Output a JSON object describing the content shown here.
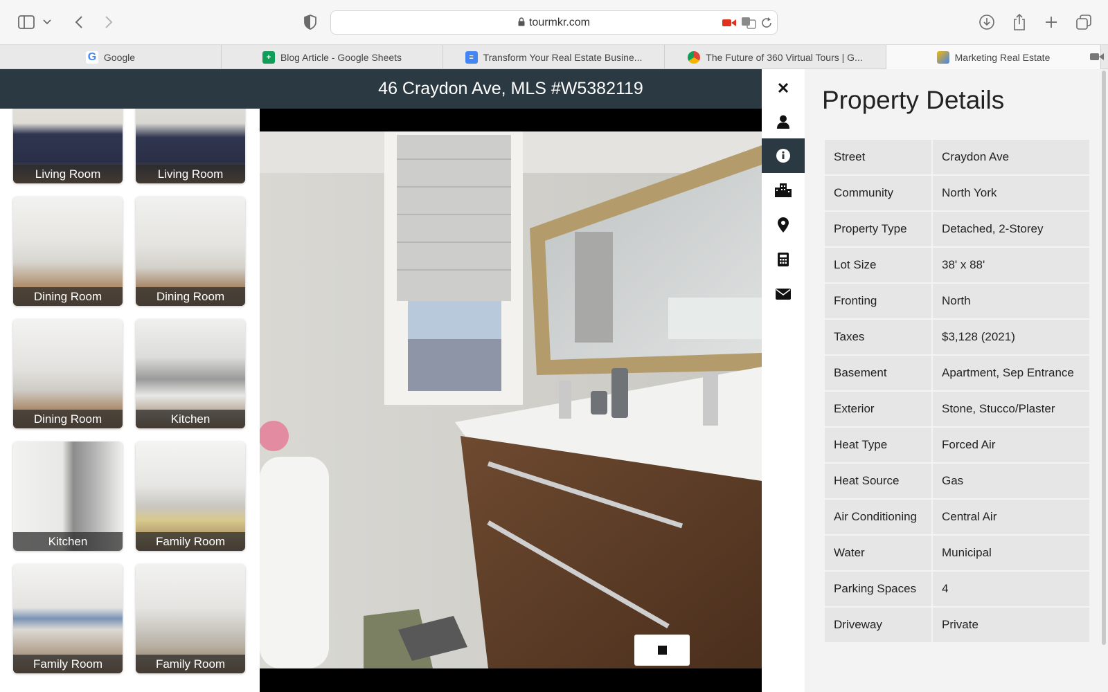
{
  "browser": {
    "url": "tourmkr.com",
    "tabs": [
      {
        "label": "Google",
        "icon": "google-icon",
        "color": "#4285f4"
      },
      {
        "label": "Blog Article - Google Sheets",
        "icon": "sheets-icon",
        "color": "#0f9d58"
      },
      {
        "label": "Transform Your Real Estate Busine...",
        "icon": "docs-icon",
        "color": "#4285f4"
      },
      {
        "label": "The Future of 360 Virtual Tours | G...",
        "icon": "chrome-icon",
        "color": "#db4437"
      },
      {
        "label": "Marketing Real Estate",
        "icon": "cube-icon",
        "color": "#f4b400"
      }
    ]
  },
  "listing": {
    "title": "46 Craydon Ave, MLS #W5382119"
  },
  "thumbnails": [
    {
      "label": "Living Room"
    },
    {
      "label": "Living Room"
    },
    {
      "label": "Dining Room"
    },
    {
      "label": "Dining Room"
    },
    {
      "label": "Dining Room"
    },
    {
      "label": "Kitchen"
    },
    {
      "label": "Kitchen"
    },
    {
      "label": "Family Room"
    },
    {
      "label": "Family Room"
    },
    {
      "label": "Family Room"
    }
  ],
  "sidebar_icons": [
    "close-icon",
    "person-icon",
    "info-icon",
    "building-icon",
    "map-pin-icon",
    "calculator-icon",
    "envelope-icon"
  ],
  "details": {
    "heading": "Property Details",
    "rows": [
      {
        "key": "Street",
        "value": "Craydon Ave"
      },
      {
        "key": "Community",
        "value": "North York"
      },
      {
        "key": "Property Type",
        "value": "Detached, 2-Storey"
      },
      {
        "key": "Lot Size",
        "value": "38' x 88'"
      },
      {
        "key": "Fronting",
        "value": "North"
      },
      {
        "key": "Taxes",
        "value": "$3,128 (2021)"
      },
      {
        "key": "Basement",
        "value": "Apartment, Sep Entrance"
      },
      {
        "key": "Exterior",
        "value": "Stone, Stucco/Plaster"
      },
      {
        "key": "Heat Type",
        "value": "Forced Air"
      },
      {
        "key": "Heat Source",
        "value": "Gas"
      },
      {
        "key": "Air Conditioning",
        "value": "Central Air"
      },
      {
        "key": "Water",
        "value": "Municipal"
      },
      {
        "key": "Parking Spaces",
        "value": "4"
      },
      {
        "key": "Driveway",
        "value": "Private"
      }
    ]
  },
  "colors": {
    "header": "#2b3a42",
    "accent_active": "#2b3a42"
  }
}
